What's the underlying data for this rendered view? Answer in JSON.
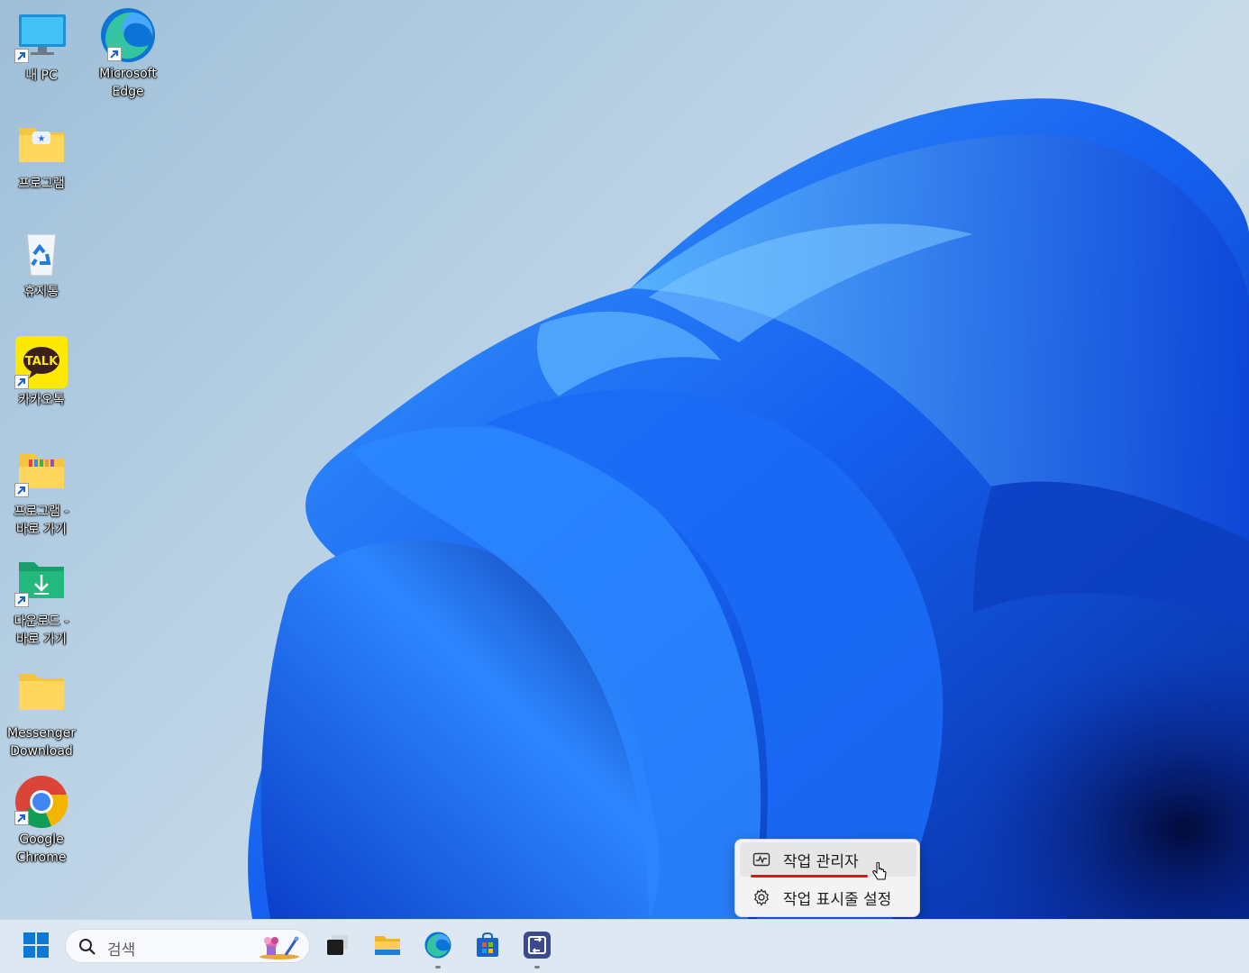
{
  "desktop": {
    "icons": [
      {
        "label": "내 PC",
        "icon": "this-pc-icon",
        "shortcut": true
      },
      {
        "label": "Microsoft\nEdge",
        "icon": "edge-icon",
        "shortcut": true
      },
      {
        "label": "프로그램",
        "icon": "folder-icon",
        "shortcut": false
      },
      {
        "label": "휴지통",
        "icon": "recycle-bin-icon",
        "shortcut": false
      },
      {
        "label": "카카오톡",
        "icon": "kakaotalk-icon",
        "shortcut": true,
        "badge": "TALK"
      },
      {
        "label": "프로그램 -\n바로 가기",
        "icon": "folder-shortcut-icon",
        "shortcut": true
      },
      {
        "label": "다운로드 -\n바로 가기",
        "icon": "downloads-folder-icon",
        "shortcut": true
      },
      {
        "label": "Messenger\nDownload",
        "icon": "folder-icon",
        "shortcut": false
      },
      {
        "label": "Google\nChrome",
        "icon": "chrome-icon",
        "shortcut": true
      }
    ]
  },
  "context_menu": {
    "items": [
      {
        "label": "작업 관리자",
        "icon": "task-manager-icon",
        "highlighted": true
      },
      {
        "label": "작업 표시줄 설정",
        "icon": "gear-icon",
        "highlighted": false
      }
    ]
  },
  "taskbar": {
    "search_placeholder": "검색",
    "apps": [
      {
        "name": "start-button",
        "icon": "windows-logo-icon"
      },
      {
        "name": "task-view",
        "icon": "task-view-icon"
      },
      {
        "name": "file-explorer",
        "icon": "file-explorer-icon"
      },
      {
        "name": "edge",
        "icon": "edge-icon",
        "running": true
      },
      {
        "name": "microsoft-store",
        "icon": "store-icon"
      },
      {
        "name": "app-pinned",
        "icon": "app-icon",
        "running": true
      }
    ]
  },
  "colors": {
    "accent": "#0a6cf0",
    "menu_underline": "#e0141a",
    "taskbar_bg": "#dde8f3"
  }
}
